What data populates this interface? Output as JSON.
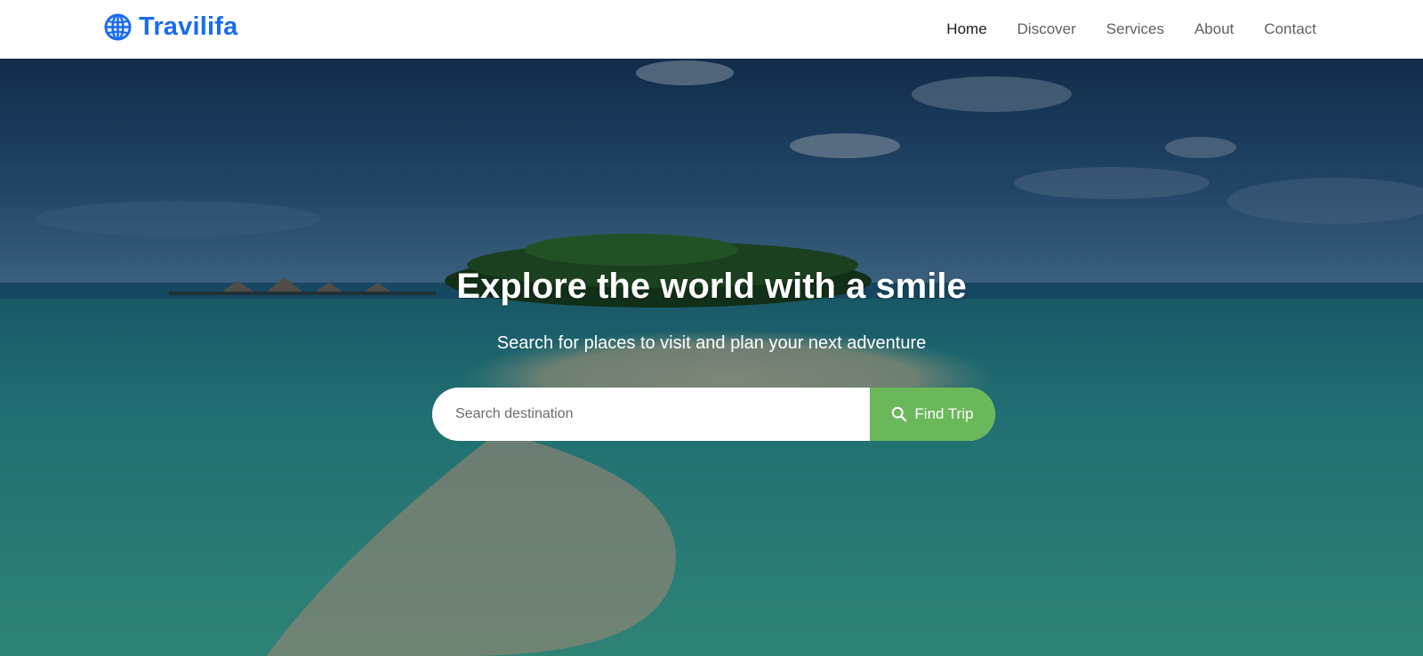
{
  "brand": {
    "name": "Travilifa",
    "icon": "globe-icon",
    "color": "#1a6cf0"
  },
  "nav": {
    "items": [
      {
        "label": "Home",
        "active": true
      },
      {
        "label": "Discover",
        "active": false
      },
      {
        "label": "Services",
        "active": false
      },
      {
        "label": "About",
        "active": false
      },
      {
        "label": "Contact",
        "active": false
      }
    ]
  },
  "hero": {
    "title": "Explore the world with a smile",
    "subtitle": "Search for places to visit and plan your next adventure",
    "background": "tropical-island-beach-image",
    "search": {
      "placeholder": "Search destination",
      "value": "",
      "button_label": "Find Trip",
      "button_icon": "search-icon",
      "button_color": "#6ab85a"
    }
  }
}
